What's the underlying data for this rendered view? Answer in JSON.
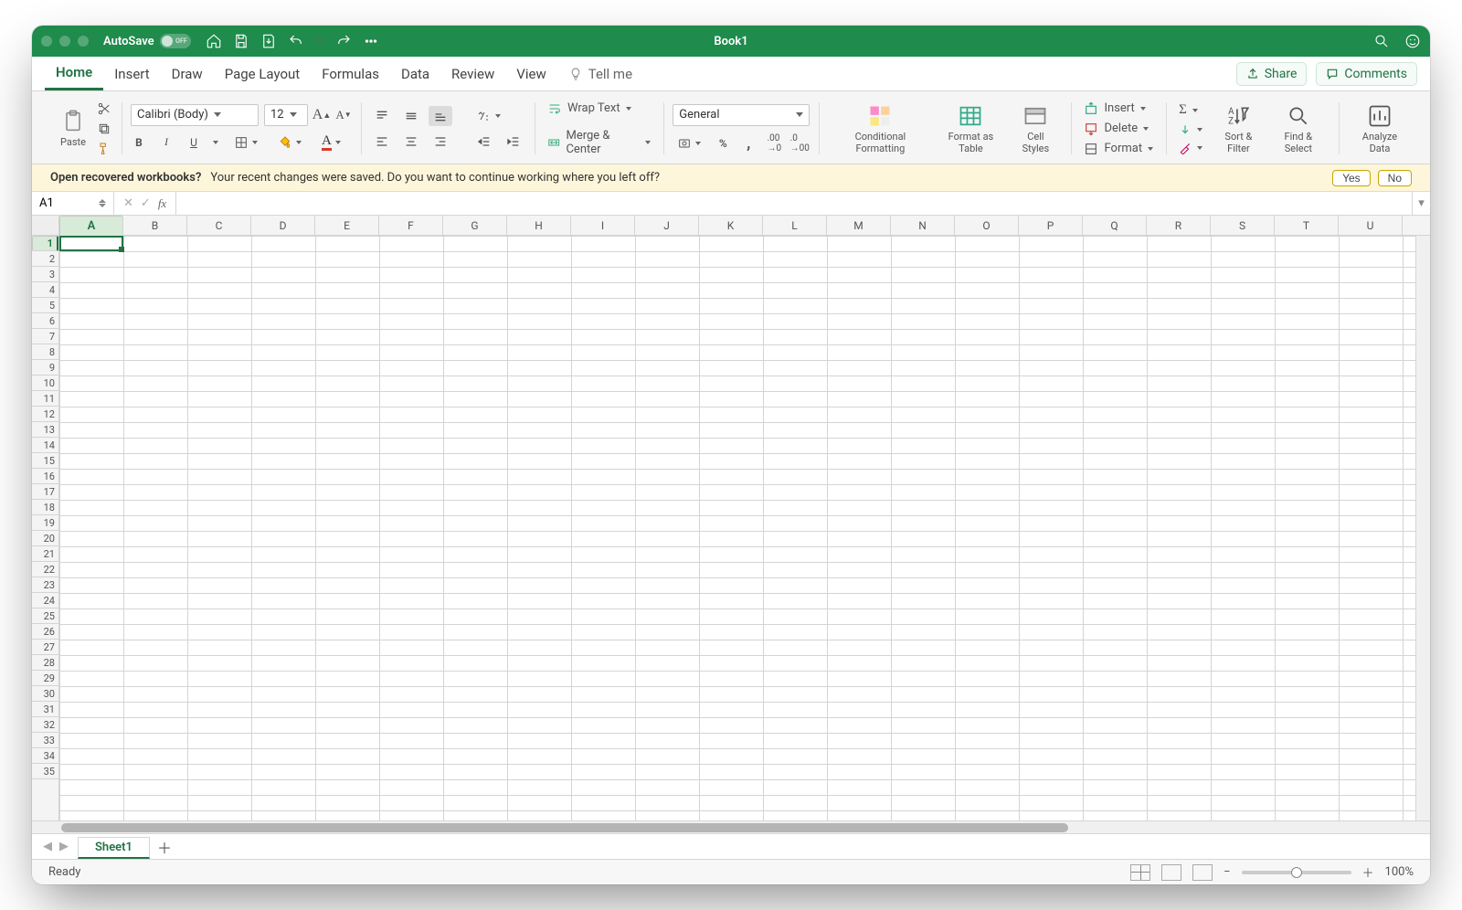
{
  "titlebar": {
    "autosave_label": "AutoSave",
    "autosave_state": "OFF",
    "filename": "Book1"
  },
  "tabs": {
    "items": [
      "Home",
      "Insert",
      "Draw",
      "Page Layout",
      "Formulas",
      "Data",
      "Review",
      "View"
    ],
    "active": "Home",
    "tell_me": "Tell me",
    "share": "Share",
    "comments": "Comments"
  },
  "ribbon": {
    "paste": "Paste",
    "font_name": "Calibri (Body)",
    "font_size": "12",
    "bold": "B",
    "italic": "I",
    "underline": "U",
    "wrap": "Wrap Text",
    "merge": "Merge & Center",
    "number_format": "General",
    "cond": "Conditional Formatting",
    "as_table": "Format as Table",
    "cell_styles": "Cell Styles",
    "insert": "Insert",
    "delete": "Delete",
    "format": "Format",
    "sort": "Sort & Filter",
    "find": "Find & Select",
    "analyze": "Analyze Data"
  },
  "message": {
    "q": "Open recovered workbooks?",
    "text": "Your recent changes were saved. Do you want to continue working where you left off?",
    "yes": "Yes",
    "no": "No"
  },
  "formula": {
    "name": "A1",
    "fx": "fx"
  },
  "grid": {
    "cols": [
      "A",
      "B",
      "C",
      "D",
      "E",
      "F",
      "G",
      "H",
      "I",
      "J",
      "K",
      "L",
      "M",
      "N",
      "O",
      "P",
      "Q",
      "R",
      "S",
      "T",
      "U"
    ],
    "rows_visible": 35,
    "selected_col": "A",
    "selected_row": 1
  },
  "sheets": {
    "active": "Sheet1"
  },
  "status": {
    "ready": "Ready",
    "zoom": "100%"
  }
}
